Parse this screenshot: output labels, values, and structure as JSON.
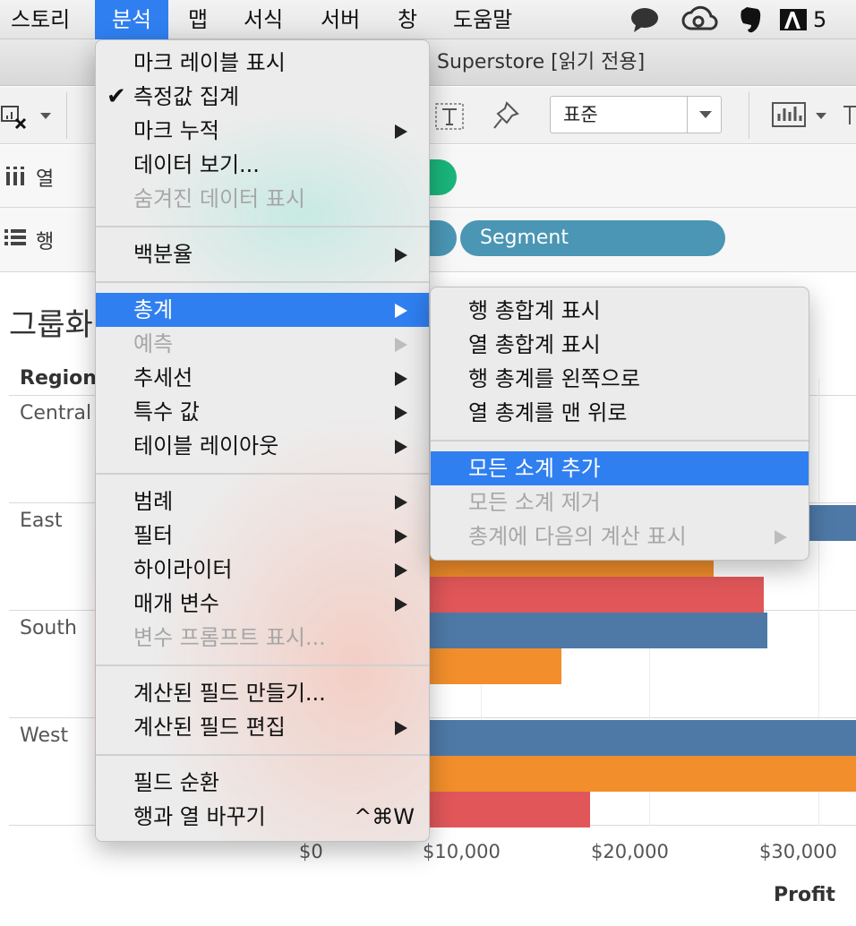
{
  "menubar": {
    "items": [
      "스토리",
      "분석",
      "맵",
      "서식",
      "서버",
      "창",
      "도움말"
    ],
    "active_index": 1,
    "right_badge": "5",
    "icons": [
      "chat-bubble-icon",
      "creative-cloud-icon",
      "evernote-icon",
      "adobe-icon"
    ]
  },
  "window": {
    "title": "Superstore [읽기 전용]"
  },
  "toolbar": {
    "mark_type": "표준",
    "icons": [
      "clear-sheet-icon",
      "text-label-icon",
      "pin-icon",
      "show-me-icon"
    ]
  },
  "shelves": {
    "columns_label": "열",
    "rows_label": "행",
    "rows_pill": "Segment"
  },
  "view": {
    "sheet_title": "그룹화",
    "region_header": "Region",
    "regions": [
      "Central",
      "East",
      "South",
      "West"
    ],
    "axis_title": "Profit",
    "ticks": [
      "$0",
      "$10,000",
      "$20,000",
      "$30,000"
    ]
  },
  "chart_data": {
    "type": "bar",
    "orientation": "horizontal",
    "categories": [
      "Central",
      "East",
      "South",
      "West"
    ],
    "series_colors": [
      "#4e79a7",
      "#f28e2b",
      "#e15759"
    ],
    "values_visible": {
      "Central": [
        null,
        null,
        null
      ],
      "East": [
        34000,
        23800,
        26800
      ],
      "South": [
        27000,
        14800,
        null
      ],
      "West": [
        34000,
        34000,
        16500
      ]
    },
    "xlabel": "Profit",
    "ylabel": "Region",
    "xlim": [
      0,
      32000
    ]
  },
  "main_menu": {
    "items": [
      {
        "label": "마크 레이블 표시"
      },
      {
        "label": "측정값 집계",
        "checked": true
      },
      {
        "label": "마크 누적",
        "submenu": true
      },
      {
        "label": "데이터 보기..."
      },
      {
        "label": "숨겨진 데이터 표시",
        "disabled": true
      },
      {
        "separator": true
      },
      {
        "label": "백분율",
        "submenu": true
      },
      {
        "separator": true
      },
      {
        "label": "총계",
        "submenu": true,
        "highlighted": true
      },
      {
        "label": "예측",
        "submenu": true,
        "disabled": true
      },
      {
        "label": "추세선",
        "submenu": true
      },
      {
        "label": "특수 값",
        "submenu": true
      },
      {
        "label": "테이블 레이아웃",
        "submenu": true
      },
      {
        "separator": true
      },
      {
        "label": "범례",
        "submenu": true
      },
      {
        "label": "필터",
        "submenu": true
      },
      {
        "label": "하이라이터",
        "submenu": true
      },
      {
        "label": "매개 변수",
        "submenu": true
      },
      {
        "label": "변수 프롬프트 표시...",
        "disabled": true
      },
      {
        "separator": true
      },
      {
        "label": "계산된 필드 만들기..."
      },
      {
        "label": "계산된 필드 편집",
        "submenu": true
      },
      {
        "separator": true
      },
      {
        "label": "필드 순환"
      },
      {
        "label": "행과 열 바꾸기",
        "shortcut": "^⌘W"
      }
    ]
  },
  "sub_menu": {
    "items": [
      {
        "label": "행 총합계 표시"
      },
      {
        "label": "열 총합계 표시"
      },
      {
        "label": "행 총계를 왼쪽으로"
      },
      {
        "label": "열 총계를 맨 위로"
      },
      {
        "separator": true
      },
      {
        "label": "모든 소계 추가",
        "highlighted": true
      },
      {
        "label": "모든 소계 제거",
        "disabled": true
      },
      {
        "label": "총계에 다음의 계산 표시",
        "submenu": true,
        "disabled": true
      }
    ]
  }
}
